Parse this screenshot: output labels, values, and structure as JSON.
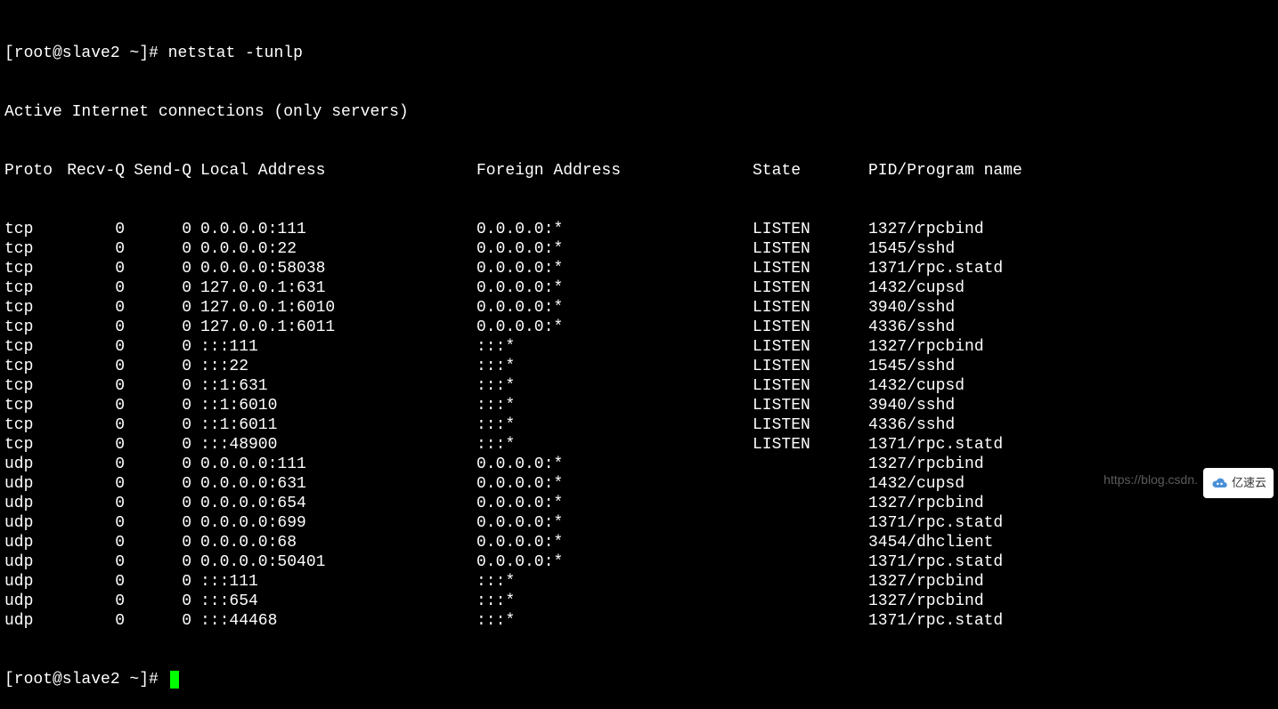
{
  "prompt1": "[root@slave2 ~]# ",
  "command": "netstat -tunlp",
  "header_line": "Active Internet connections (only servers)",
  "columns": {
    "proto": "Proto",
    "recvq": "Recv-Q",
    "sendq": "Send-Q",
    "local": "Local Address",
    "foreign": "Foreign Address",
    "state": "State",
    "pid": "PID/Program name"
  },
  "rows": [
    {
      "proto": "tcp",
      "recvq": "0",
      "sendq": "0",
      "local": "0.0.0.0:111",
      "foreign": "0.0.0.0:*",
      "state": "LISTEN",
      "pid": "1327/rpcbind"
    },
    {
      "proto": "tcp",
      "recvq": "0",
      "sendq": "0",
      "local": "0.0.0.0:22",
      "foreign": "0.0.0.0:*",
      "state": "LISTEN",
      "pid": "1545/sshd"
    },
    {
      "proto": "tcp",
      "recvq": "0",
      "sendq": "0",
      "local": "0.0.0.0:58038",
      "foreign": "0.0.0.0:*",
      "state": "LISTEN",
      "pid": "1371/rpc.statd"
    },
    {
      "proto": "tcp",
      "recvq": "0",
      "sendq": "0",
      "local": "127.0.0.1:631",
      "foreign": "0.0.0.0:*",
      "state": "LISTEN",
      "pid": "1432/cupsd"
    },
    {
      "proto": "tcp",
      "recvq": "0",
      "sendq": "0",
      "local": "127.0.0.1:6010",
      "foreign": "0.0.0.0:*",
      "state": "LISTEN",
      "pid": "3940/sshd"
    },
    {
      "proto": "tcp",
      "recvq": "0",
      "sendq": "0",
      "local": "127.0.0.1:6011",
      "foreign": "0.0.0.0:*",
      "state": "LISTEN",
      "pid": "4336/sshd"
    },
    {
      "proto": "tcp",
      "recvq": "0",
      "sendq": "0",
      "local": ":::111",
      "foreign": ":::*",
      "state": "LISTEN",
      "pid": "1327/rpcbind"
    },
    {
      "proto": "tcp",
      "recvq": "0",
      "sendq": "0",
      "local": ":::22",
      "foreign": ":::*",
      "state": "LISTEN",
      "pid": "1545/sshd"
    },
    {
      "proto": "tcp",
      "recvq": "0",
      "sendq": "0",
      "local": "::1:631",
      "foreign": ":::*",
      "state": "LISTEN",
      "pid": "1432/cupsd"
    },
    {
      "proto": "tcp",
      "recvq": "0",
      "sendq": "0",
      "local": "::1:6010",
      "foreign": ":::*",
      "state": "LISTEN",
      "pid": "3940/sshd"
    },
    {
      "proto": "tcp",
      "recvq": "0",
      "sendq": "0",
      "local": "::1:6011",
      "foreign": ":::*",
      "state": "LISTEN",
      "pid": "4336/sshd"
    },
    {
      "proto": "tcp",
      "recvq": "0",
      "sendq": "0",
      "local": ":::48900",
      "foreign": ":::*",
      "state": "LISTEN",
      "pid": "1371/rpc.statd"
    },
    {
      "proto": "udp",
      "recvq": "0",
      "sendq": "0",
      "local": "0.0.0.0:111",
      "foreign": "0.0.0.0:*",
      "state": "",
      "pid": "1327/rpcbind"
    },
    {
      "proto": "udp",
      "recvq": "0",
      "sendq": "0",
      "local": "0.0.0.0:631",
      "foreign": "0.0.0.0:*",
      "state": "",
      "pid": "1432/cupsd"
    },
    {
      "proto": "udp",
      "recvq": "0",
      "sendq": "0",
      "local": "0.0.0.0:654",
      "foreign": "0.0.0.0:*",
      "state": "",
      "pid": "1327/rpcbind"
    },
    {
      "proto": "udp",
      "recvq": "0",
      "sendq": "0",
      "local": "0.0.0.0:699",
      "foreign": "0.0.0.0:*",
      "state": "",
      "pid": "1371/rpc.statd"
    },
    {
      "proto": "udp",
      "recvq": "0",
      "sendq": "0",
      "local": "0.0.0.0:68",
      "foreign": "0.0.0.0:*",
      "state": "",
      "pid": "3454/dhclient"
    },
    {
      "proto": "udp",
      "recvq": "0",
      "sendq": "0",
      "local": "0.0.0.0:50401",
      "foreign": "0.0.0.0:*",
      "state": "",
      "pid": "1371/rpc.statd"
    },
    {
      "proto": "udp",
      "recvq": "0",
      "sendq": "0",
      "local": ":::111",
      "foreign": ":::*",
      "state": "",
      "pid": "1327/rpcbind"
    },
    {
      "proto": "udp",
      "recvq": "0",
      "sendq": "0",
      "local": ":::654",
      "foreign": ":::*",
      "state": "",
      "pid": "1327/rpcbind"
    },
    {
      "proto": "udp",
      "recvq": "0",
      "sendq": "0",
      "local": ":::44468",
      "foreign": ":::*",
      "state": "",
      "pid": "1371/rpc.statd"
    }
  ],
  "prompt2": "[root@slave2 ~]# ",
  "watermark_text": "https://blog.csdn.",
  "watermark_logo": "亿速云"
}
